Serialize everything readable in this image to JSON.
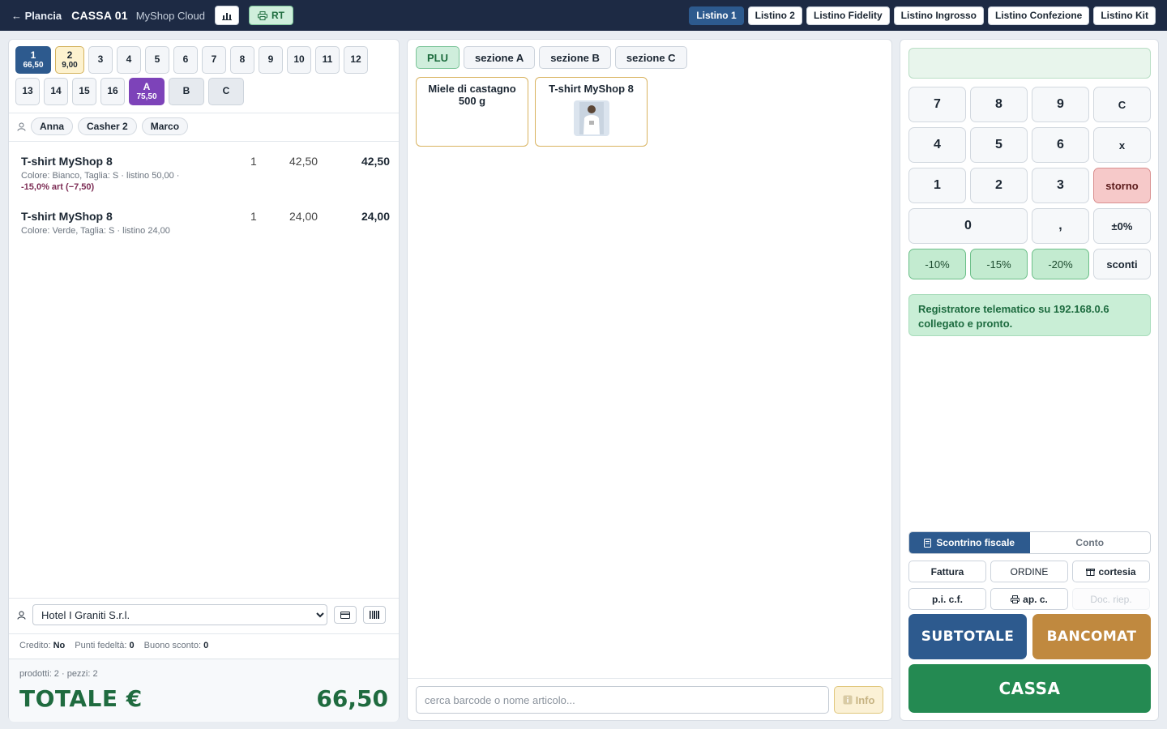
{
  "header": {
    "back_label": "← Plancia",
    "title": "CASSA 01",
    "brand": "MyShop Cloud",
    "rt_label": "RT",
    "listini": [
      {
        "label": "Listino 1",
        "active": true
      },
      {
        "label": "Listino 2"
      },
      {
        "label": "Listino Fidelity"
      },
      {
        "label": "Listino Ingrosso"
      },
      {
        "label": "Listino Confezione"
      },
      {
        "label": "Listino Kit"
      }
    ]
  },
  "tables": {
    "t1": {
      "num": "1",
      "amount": "66,50"
    },
    "t2": {
      "num": "2",
      "amount": "9,00"
    },
    "t3": "3",
    "t4": "4",
    "t5": "5",
    "t6": "6",
    "t7": "7",
    "t8": "8",
    "t9": "9",
    "t10": "10",
    "t11": "11",
    "t12": "12",
    "t13": "13",
    "t14": "14",
    "t15": "15",
    "t16": "16",
    "tA": {
      "num": "A",
      "amount": "75,50"
    },
    "tB": "B",
    "tC": "C"
  },
  "cashiers": [
    "Anna",
    "Casher 2",
    "Marco"
  ],
  "receipt": {
    "lines": [
      {
        "name": "T-shirt MyShop 8",
        "qty": "1",
        "price": "42,50",
        "total": "42,50",
        "detail": "Colore: Bianco, Taglia: S · listino 50,00 ·",
        "discount": "-15,0% art (−7,50)"
      },
      {
        "name": "T-shirt MyShop 8",
        "qty": "1",
        "price": "24,00",
        "total": "24,00",
        "detail": "Colore: Verde, Taglia: S · listino 24,00"
      }
    ],
    "customer": "Hotel I Graniti S.r.l.",
    "credit_label": "Credito:",
    "credit_value": "No",
    "points_label": "Punti fedeltà:",
    "points_value": "0",
    "voucher_label": "Buono sconto:",
    "voucher_value": "0",
    "counts": "prodotti: 2 · pezzi: 2",
    "total_label": "TOTALE €",
    "total_value": "66,50"
  },
  "sections": [
    "PLU",
    "sezione A",
    "sezione B",
    "sezione C"
  ],
  "products": [
    {
      "name": "Miele di castagno 500 g"
    },
    {
      "name": "T-shirt MyShop 8"
    }
  ],
  "search": {
    "placeholder": "cerca barcode o nome articolo...",
    "info_label": "Info"
  },
  "keypad": {
    "k7": "7",
    "k8": "8",
    "k9": "9",
    "kC": "C",
    "k4": "4",
    "k5": "5",
    "k6": "6",
    "kx": "x",
    "k1": "1",
    "k2": "2",
    "k3": "3",
    "storno": "storno",
    "k0": "0",
    "comma": ",",
    "pm": "±0%",
    "d10": "-10%",
    "d15": "-15%",
    "d20": "-20%",
    "sconti": "sconti"
  },
  "status_message": "Registratore telematico su 192.168.0.6 collegato e pronto.",
  "doc_tabs": {
    "receipt": "Scontrino fiscale",
    "bill": "Conto"
  },
  "doc_buttons": {
    "fattura": "Fattura",
    "ordine": "ORDINE",
    "cortesia": "cortesia",
    "picf": "p.i. c.f.",
    "apc": "ap. c.",
    "docriep": "Doc. riep."
  },
  "actions": {
    "subtotale": "SUBTOTALE",
    "bancomat": "BANCOMAT",
    "cassa": "CASSA"
  },
  "colors": {
    "topbar": "#1d2a44",
    "accent_blue": "#2d5a8e",
    "green": "#248a52",
    "gold": "#c0893f",
    "purple": "#7d43b9"
  }
}
